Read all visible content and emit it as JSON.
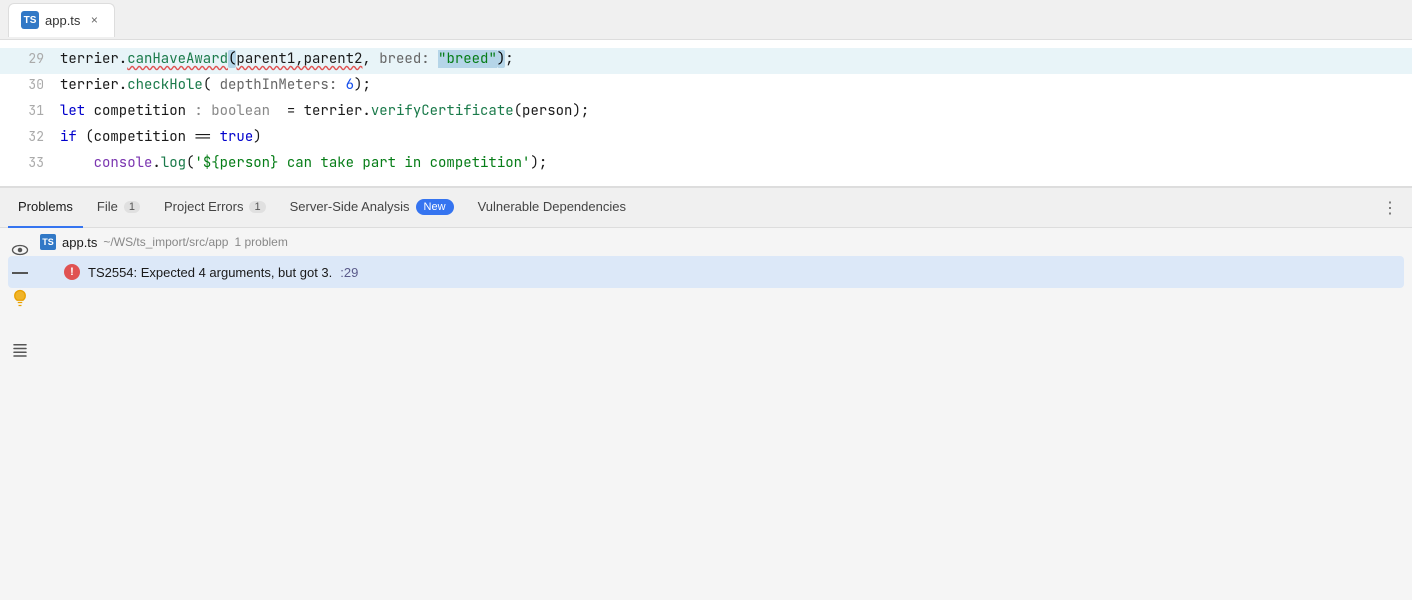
{
  "tab": {
    "icon": "TS",
    "name": "app.ts",
    "close_label": "×"
  },
  "code": {
    "lines": [
      {
        "num": 29,
        "highlighted": true,
        "raw": "terrier.canHaveAward(parent1,parent2, breed: \"breed\");"
      },
      {
        "num": 30,
        "highlighted": false,
        "raw": "terrier.checkHole( depthInMeters: 6);"
      },
      {
        "num": 31,
        "highlighted": false,
        "raw": "let competition : boolean  = terrier.verifyCertificate(person);"
      },
      {
        "num": 32,
        "highlighted": false,
        "raw": "if (competition == true)"
      },
      {
        "num": 33,
        "highlighted": false,
        "raw": "    console.log('${person} can take part in competition');"
      }
    ]
  },
  "problems_panel": {
    "tabs": [
      {
        "id": "problems",
        "label": "Problems",
        "badge": null,
        "active": true
      },
      {
        "id": "file",
        "label": "File",
        "badge": "1",
        "active": false
      },
      {
        "id": "project-errors",
        "label": "Project Errors",
        "badge": "1",
        "active": false
      },
      {
        "id": "server-side",
        "label": "Server-Side Analysis",
        "badge": null,
        "new_badge": "New",
        "active": false
      },
      {
        "id": "vulnerable",
        "label": "Vulnerable Dependencies",
        "badge": null,
        "active": false
      }
    ],
    "more_button": "⋮",
    "file_entry": {
      "icon": "TS",
      "filename": "app.ts",
      "path": "~/WS/ts_import/src/app",
      "count": "1 problem"
    },
    "error": {
      "message": "TS2554: Expected 4 arguments, but got 3.",
      "location": ":29"
    }
  },
  "side_icons": {
    "eye_icon": "👁",
    "bulb_icon": "💡",
    "list_icon": "🗒"
  }
}
